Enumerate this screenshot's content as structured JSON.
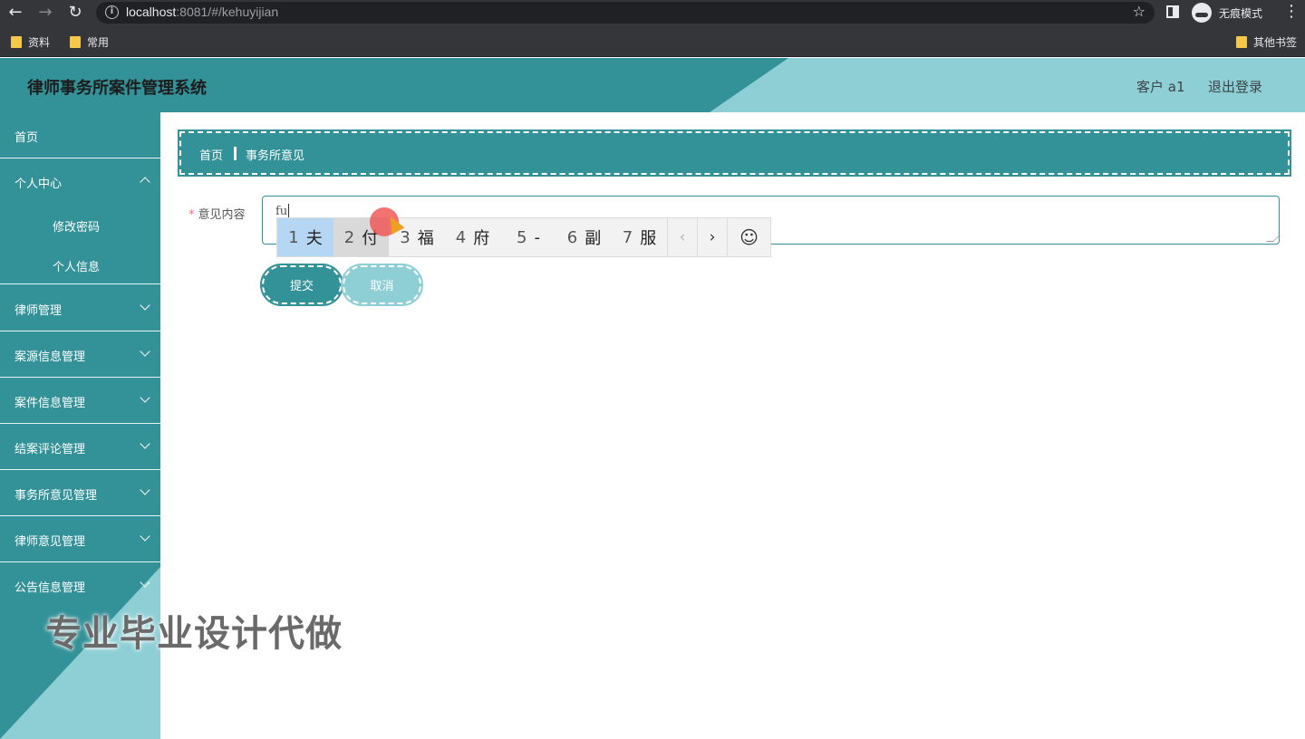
{
  "browser": {
    "url_host": "localhost",
    "url_rest": ":8081/#/kehuyijian",
    "incognito_label": "无痕模式",
    "bookmarks": [
      "资料",
      "常用"
    ],
    "other_bookmarks": "其他书签"
  },
  "header": {
    "title": "律师事务所案件管理系统",
    "user": "客户 a1",
    "logout": "退出登录"
  },
  "sidebar": {
    "items": [
      {
        "label": "首页"
      },
      {
        "label": "个人中心"
      },
      {
        "label": "律师管理"
      },
      {
        "label": "案源信息管理"
      },
      {
        "label": "案件信息管理"
      },
      {
        "label": "结案评论管理"
      },
      {
        "label": "事务所意见管理"
      },
      {
        "label": "律师意见管理"
      },
      {
        "label": "公告信息管理"
      }
    ],
    "subitems": [
      {
        "label": "修改密码"
      },
      {
        "label": "个人信息"
      }
    ]
  },
  "breadcrumb": {
    "home": "首页",
    "current": "事务所意见"
  },
  "form": {
    "required_mark": "*",
    "label": "意见内容",
    "value": "fu"
  },
  "ime": {
    "candidates": [
      {
        "num": "1",
        "text": "夫"
      },
      {
        "num": "2",
        "text": "付"
      },
      {
        "num": "3",
        "text": "福"
      },
      {
        "num": "4",
        "text": "府"
      },
      {
        "num": "5",
        "text": "-"
      },
      {
        "num": "6",
        "text": "副"
      },
      {
        "num": "7",
        "text": "服"
      }
    ],
    "prev": "‹",
    "next": "›",
    "emoji": "☺"
  },
  "buttons": {
    "submit": "提交",
    "cancel": "取消"
  },
  "watermark": "专业毕业设计代做",
  "colors": {
    "primary": "#339198",
    "light": "#8ecfd6"
  }
}
